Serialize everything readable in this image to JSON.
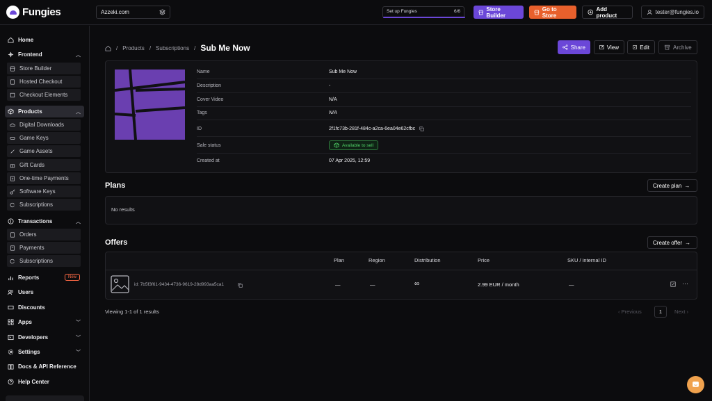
{
  "app": {
    "name": "Fungies"
  },
  "topbar": {
    "store": "Azzeki.com",
    "setup_label": "Set up Fungies",
    "setup_progress": "6/6",
    "store_builder": "Store Builder",
    "go_to_store": "Go to Store",
    "add_product": "Add product",
    "user": "tester@fungies.io"
  },
  "sidebar": {
    "home": "Home",
    "frontend": "Frontend",
    "frontend_items": [
      "Store Builder",
      "Hosted Checkout",
      "Checkout Elements"
    ],
    "products": "Products",
    "product_items": [
      "Digital Downloads",
      "Game Keys",
      "Game Assets",
      "Gift Cards",
      "One-time Payments",
      "Software Keys",
      "Subscriptions"
    ],
    "transactions": "Transactions",
    "transaction_items": [
      "Orders",
      "Payments",
      "Subscriptions"
    ],
    "reports": "Reports",
    "reports_badge": "New",
    "users": "Users",
    "discounts": "Discounts",
    "apps": "Apps",
    "developers": "Developers",
    "settings": "Settings",
    "docs": "Docs & API Reference",
    "help": "Help Center"
  },
  "breadcrumb": {
    "products": "Products",
    "subscriptions": "Subscriptions",
    "current": "Sub Me Now"
  },
  "actions": {
    "share": "Share",
    "view": "View",
    "edit": "Edit",
    "archive": "Archive"
  },
  "details": {
    "name_label": "Name",
    "name": "Sub Me Now",
    "description_label": "Description",
    "description": "-",
    "cover_label": "Cover Video",
    "cover": "N/A",
    "tags_label": "Tags",
    "tags": "N/A",
    "id_label": "ID",
    "id": "2f1fc73b-281f-484c-a2ca-6ea04e62cfbc",
    "status_label": "Sale status",
    "status": "Available to sell",
    "created_label": "Created at",
    "created": "07 Apr 2025, 12:59"
  },
  "plans": {
    "title": "Plans",
    "create": "Create plan",
    "empty": "No results"
  },
  "offers": {
    "title": "Offers",
    "create": "Create offer",
    "columns": [
      "Plan",
      "Region",
      "Distribution",
      "Price",
      "SKU / internal ID"
    ],
    "row": {
      "id": "id: 7b5f3f61-9434-4736-9619-28d993aa5ca1",
      "plan": "—",
      "region": "—",
      "distribution": "∞",
      "price": "2.99 EUR / month",
      "sku": "—"
    }
  },
  "pagination": {
    "summary": "Viewing 1-1 of 1 results",
    "previous": "Previous",
    "page": "1",
    "next": "Next"
  },
  "colors": {
    "accent": "#6b47d8",
    "orange": "#e8602c",
    "success": "#4fcf66"
  }
}
